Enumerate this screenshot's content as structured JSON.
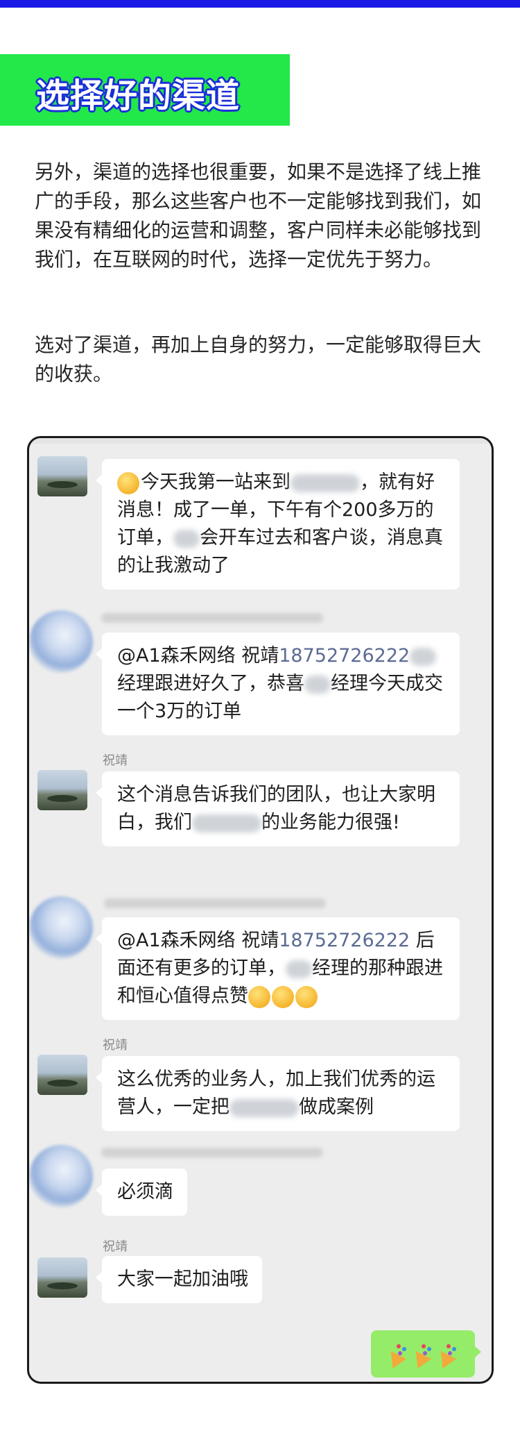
{
  "article": {
    "section_heading": "选择好的渠道",
    "paragraph1": "另外，渠道的选择也很重要，如果不是选择了线上推广的手段，那么这些客户也不一定能够找到我们，如果没有精细化的运营和调整，客户同样未必能够找到我们，在互联网的时代，选择一定优先于努力。",
    "paragraph2": "选对了渠道，再加上自身的努力，一定能够取得巨大的收获。"
  },
  "colors": {
    "top_bar": "#1a1ae6",
    "heading_bg": "#22e84a",
    "heading_outline": "#1a2fd6",
    "chat_bg": "#ededed",
    "my_bubble": "#95ec69",
    "mention_phone": "#5b6b93"
  },
  "chat": {
    "messages": [
      {
        "sender": "",
        "parts": [
          "今天我第一站来到",
          "，就有好消息！成了一单，下午有个200多万的订单，",
          "会开车过去和客户谈，消息真的让我激动了"
        ]
      },
      {
        "sender": "",
        "mention": "@A1森禾网络 祝靖",
        "phone": "18752726222",
        "parts": [
          "经理跟进好久了，恭喜",
          "经理今天成交一个3万的订单"
        ]
      },
      {
        "sender": "祝靖",
        "parts": [
          "这个消息告诉我们的团队，也让大家明白，我们",
          "的业务能力很强!"
        ]
      },
      {
        "sender": "",
        "mention": "@A1森禾网络 祝靖",
        "phone": "18752726222",
        "parts": [
          "后面还有更多的订单，",
          "经理的那种跟进和恒心值得点赞"
        ]
      },
      {
        "sender": "祝靖",
        "parts": [
          "这么优秀的业务人，加上我们优秀的运营人，一定把",
          "做成案例"
        ]
      },
      {
        "sender": "",
        "text": "必须滴"
      },
      {
        "sender": "祝靖",
        "text": "大家一起加油哦"
      }
    ],
    "my_reply": {
      "emoji_icons": [
        "party-popper-icon",
        "party-popper-icon",
        "party-popper-icon"
      ]
    }
  }
}
